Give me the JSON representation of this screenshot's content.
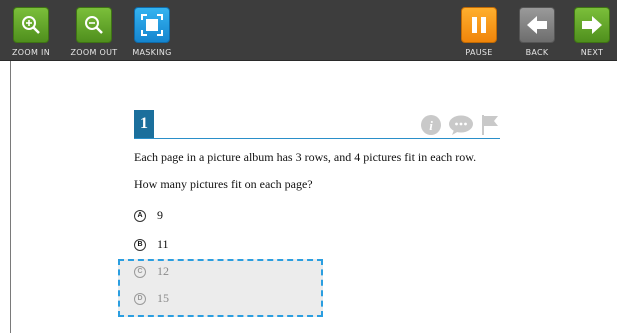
{
  "toolbar": {
    "zoom_in": "ZOOM IN",
    "zoom_out": "ZOOM OUT",
    "masking": "MASKING",
    "pause": "PAUSE",
    "back": "BACK",
    "next": "NEXT"
  },
  "question": {
    "number": "1",
    "stem_line1": "Each page in a picture album has 3 rows, and 4 pictures fit in each row.",
    "stem_line2": "How many pictures fit on each page?",
    "options": [
      {
        "letter": "A",
        "text": "9"
      },
      {
        "letter": "B",
        "text": "11"
      },
      {
        "letter": "C",
        "text": "12"
      },
      {
        "letter": "D",
        "text": "15"
      }
    ]
  },
  "colors": {
    "toolbar_bg": "#3d3d3d",
    "green": "#5fa52a",
    "blue": "#1f9be0",
    "orange": "#f7941d",
    "accent": "#1b6f9c",
    "mask_border": "#2b9ee0"
  },
  "icons": [
    "zoom-in-icon",
    "zoom-out-icon",
    "masking-icon",
    "pause-icon",
    "back-arrow-icon",
    "next-arrow-icon",
    "info-icon",
    "comment-icon",
    "flag-icon"
  ]
}
